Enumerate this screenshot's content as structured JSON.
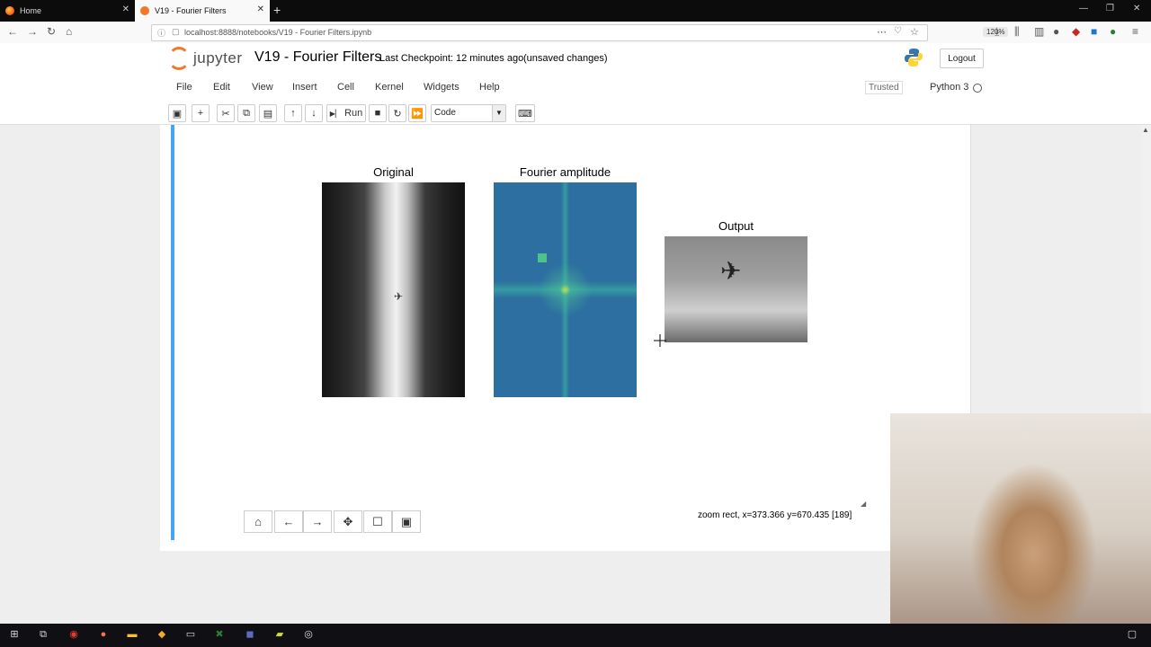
{
  "browser": {
    "tabs": [
      {
        "label": "Home"
      },
      {
        "label": "V19 - Fourier Filters"
      }
    ],
    "url": "localhost:8888/notebooks/V19 - Fourier Filters.ipynb",
    "zoom": "120%"
  },
  "jupyter": {
    "logo_text": "jupyter",
    "title": "V19 - Fourier Filters",
    "checkpoint": "Last Checkpoint: 12 minutes ago",
    "unsaved": "(unsaved changes)",
    "logout": "Logout",
    "menu": [
      "File",
      "Edit",
      "View",
      "Insert",
      "Cell",
      "Kernel",
      "Widgets",
      "Help"
    ],
    "trusted": "Trusted",
    "kernel": "Python 3",
    "toolbar": {
      "run_label": "Run",
      "cell_type": "Code"
    }
  },
  "figure": {
    "panels": [
      {
        "title": "Original"
      },
      {
        "title": "Fourier amplitude"
      },
      {
        "title": "Output"
      }
    ],
    "status": "zoom rect, x=373.366 y=670.435 [189]"
  },
  "colors": {
    "cell_selected_bar": "#42a5f5",
    "jupyter_orange": "#f37726"
  },
  "icons": {
    "mpl_toolbar": [
      "home-icon",
      "back-arrow-icon",
      "forward-arrow-icon",
      "pan-icon",
      "zoom-rect-icon",
      "save-icon"
    ]
  }
}
